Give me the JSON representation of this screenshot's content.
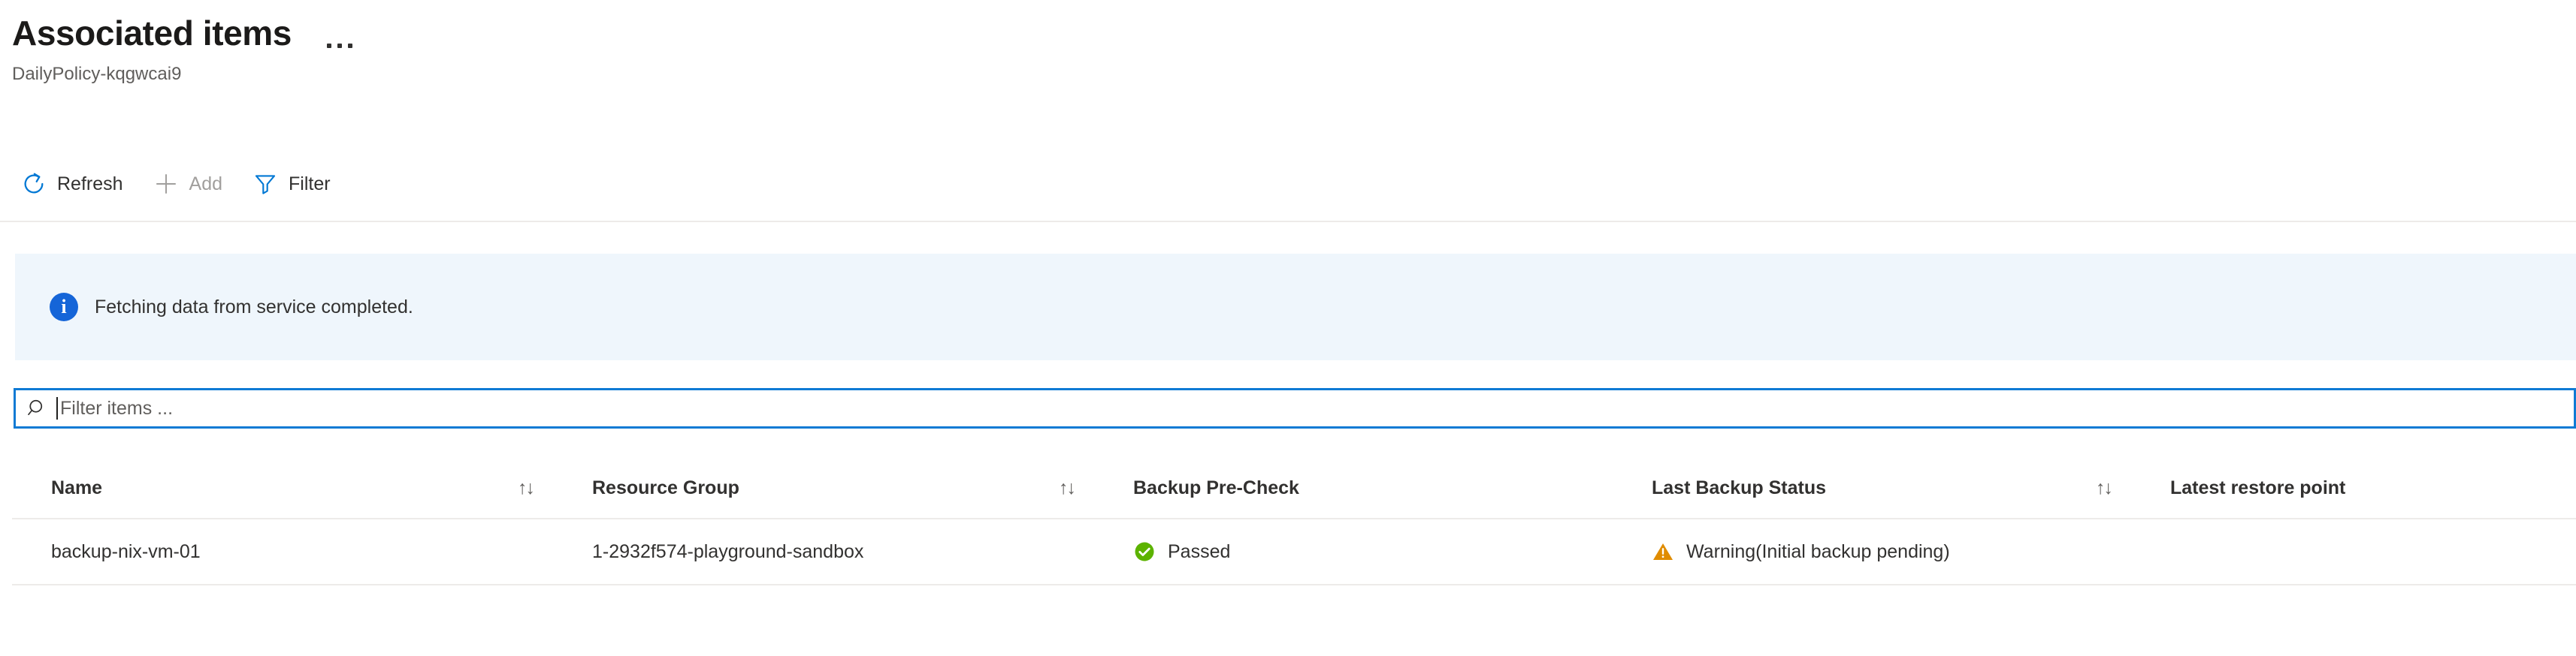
{
  "header": {
    "title": "Associated items",
    "subtitle": "DailyPolicy-kqgwcai9",
    "more_menu_label": "..."
  },
  "toolbar": {
    "items": [
      {
        "label": "Refresh",
        "icon": "refresh-icon",
        "disabled": false
      },
      {
        "label": "Add",
        "icon": "plus-icon",
        "disabled": true
      },
      {
        "label": "Filter",
        "icon": "funnel-icon",
        "disabled": false
      }
    ]
  },
  "banner": {
    "icon": "info-icon",
    "glyph": "i",
    "message": "Fetching data from service completed.",
    "background": "#eff6fc"
  },
  "filter": {
    "icon": "search-icon",
    "placeholder": "Filter items ...",
    "value": ""
  },
  "grid": {
    "columns": [
      {
        "label": "Name",
        "sortable": true,
        "sort_glyph": "↑↓"
      },
      {
        "label": "Resource Group",
        "sortable": true,
        "sort_glyph": "↑↓"
      },
      {
        "label": "Backup Pre-Check",
        "sortable": false,
        "sort_glyph": ""
      },
      {
        "label": "Last Backup Status",
        "sortable": true,
        "sort_glyph": "↑↓"
      },
      {
        "label": "Latest restore point",
        "sortable": false,
        "sort_glyph": ""
      }
    ],
    "rows": [
      {
        "name": "backup-nix-vm-01",
        "resource_group": "1-2932f574-playground-sandbox",
        "pre_check": "Passed",
        "pre_check_icon": "check-circle-icon",
        "pre_check_color": "#5cb300",
        "last_backup_status": "Warning(Initial backup pending)",
        "last_backup_icon": "warning-triangle-icon",
        "last_backup_color": "#e08c00",
        "latest_restore_point": ""
      }
    ]
  },
  "colors": {
    "accent": "#0078d4",
    "focus_border": "#0f7ad4",
    "divider": "#edebe9",
    "text_primary": "#323130",
    "text_secondary": "#605e5c",
    "disabled_text": "#a19f9d"
  }
}
